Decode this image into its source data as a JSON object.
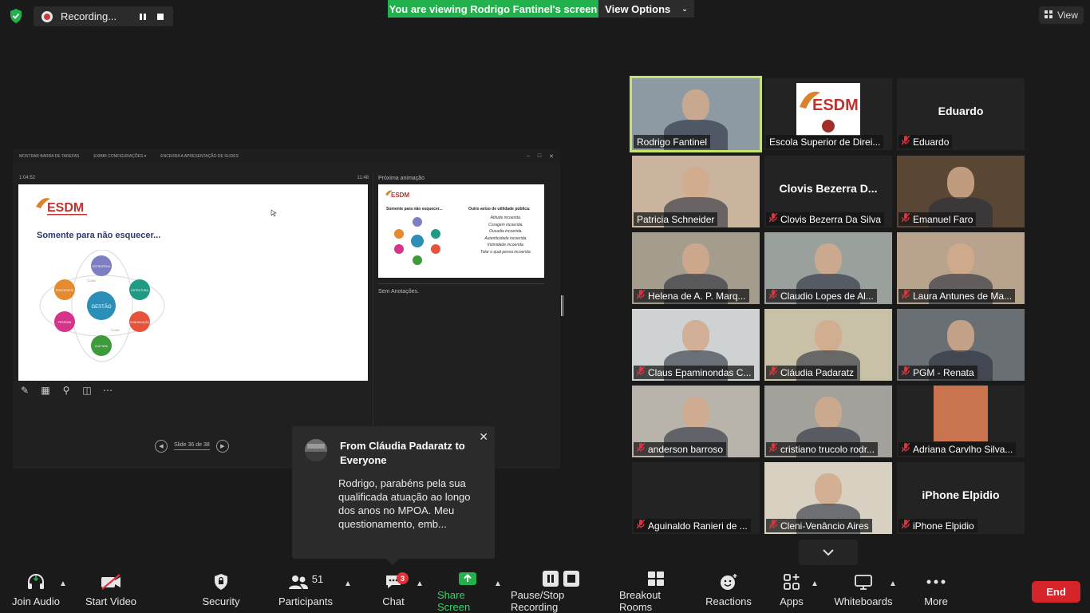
{
  "top": {
    "recording_label": "Recording...",
    "viewing_banner": "You are viewing Rodrigo Fantinel's screen",
    "view_options_label": "View Options",
    "view_label": "View"
  },
  "shared_screen": {
    "ppt_toolbar": [
      "MOSTRAR BARRA DE TAREFAS",
      "EXIBIR CONFIGURAÇÕES ▾",
      "ENCERRA A APRESENTAÇÃO DE SLIDES"
    ],
    "elapsed": "1:04:52",
    "clock": "11:48",
    "slide_logo": "ESDM",
    "slide_title": "Somente para não esquecer...",
    "diagram": {
      "center": "GESTÃO",
      "nodes": [
        "ESTRATÉGIA",
        "ESTRUTURA",
        "COMUNICAÇÃO",
        "CULTURA",
        "PESSOAS",
        "PROCESSOS"
      ],
      "ring_labels": [
        "CLIMA",
        "CLIMA"
      ]
    },
    "next_animation_label": "Próxima animação",
    "next_slide": {
      "logo": "ESDM",
      "left_title": "Somente para não esquecer...",
      "right_title": "Outro aviso de utilidade pública:",
      "lines": [
        "Atitude incoerida.",
        "Coragem incoerida.",
        "Ousadia incoerida.",
        "Autenticidade incoerida.",
        "Intimidade incoerida.",
        "Tolar o qual pensa incoerida."
      ]
    },
    "notes_label": "Sem Anotações.",
    "slide_counter": "Slide 36 de 38"
  },
  "gallery": [
    {
      "name": "Rodrigo Fantinel",
      "muted": false,
      "video": true,
      "active": true,
      "bg": "#8d9aa3"
    },
    {
      "name": "Escola Superior de Direi...",
      "muted": false,
      "video": true,
      "logo": true,
      "bg": "#232323"
    },
    {
      "name": "Eduardo",
      "muted": true,
      "video": false,
      "big": "Eduardo"
    },
    {
      "name": "Patricia Schneider",
      "muted": false,
      "video": true,
      "bg": "#cbb49e"
    },
    {
      "name": "Clovis Bezerra Da Silva",
      "muted": true,
      "video": false,
      "big": "Clovis Bezerra D..."
    },
    {
      "name": "Emanuel Faro",
      "muted": true,
      "video": true,
      "bg": "#5a4634"
    },
    {
      "name": "Helena de A. P. Marq...",
      "muted": true,
      "video": true,
      "bg": "#a49c8c"
    },
    {
      "name": "Claudio Lopes de Al...",
      "muted": true,
      "video": true,
      "bg": "#9aa09b"
    },
    {
      "name": "Laura Antunes de Ma...",
      "muted": true,
      "video": true,
      "bg": "#b8a48c"
    },
    {
      "name": "Claus Epaminondas C...",
      "muted": true,
      "video": true,
      "bg": "#cfd2d3"
    },
    {
      "name": "Cláudia Padaratz",
      "muted": true,
      "video": true,
      "bg": "#c9c0a8"
    },
    {
      "name": "PGM - Renata",
      "muted": true,
      "video": true,
      "bg": "#6a6f73"
    },
    {
      "name": "anderson barroso",
      "muted": true,
      "video": true,
      "bg": "#b9b4ab"
    },
    {
      "name": "cristiano trucolo rodr...",
      "muted": true,
      "video": true,
      "bg": "#a3a19c"
    },
    {
      "name": "Adriana Carvlho Silva...",
      "muted": true,
      "video": true,
      "bg": "#232323",
      "inset": "#c9744e"
    },
    {
      "name": "Aguinaldo Ranieri de ...",
      "muted": true,
      "video": false,
      "big": ""
    },
    {
      "name": "Cleni-Venâncio Aires",
      "muted": true,
      "video": true,
      "bg": "#d8d1c2"
    },
    {
      "name": "iPhone Elpidio",
      "muted": true,
      "video": false,
      "big": "iPhone Elpidio"
    }
  ],
  "chat_popup": {
    "from": "From Cláudia Padaratz to Everyone",
    "message": "Rodrigo, parabéns pela sua qualificada atuação ao longo dos anos no MPOA. Meu questionamento, emb..."
  },
  "toolbar": {
    "join_audio": "Join Audio",
    "start_video": "Start Video",
    "security": "Security",
    "participants": "Participants",
    "participants_count": "51",
    "chat": "Chat",
    "chat_badge": "3",
    "share_screen": "Share Screen",
    "pause_stop_recording": "Pause/Stop Recording",
    "breakout_rooms": "Breakout Rooms",
    "reactions": "Reactions",
    "apps": "Apps",
    "whiteboards": "Whiteboards",
    "more": "More",
    "end": "End"
  },
  "colors": {
    "banner_green": "#23b14d",
    "active_speaker": "#c8e36a",
    "mute_red": "#e0323c",
    "end_red": "#d6242b",
    "share_green": "#3bd36a"
  }
}
